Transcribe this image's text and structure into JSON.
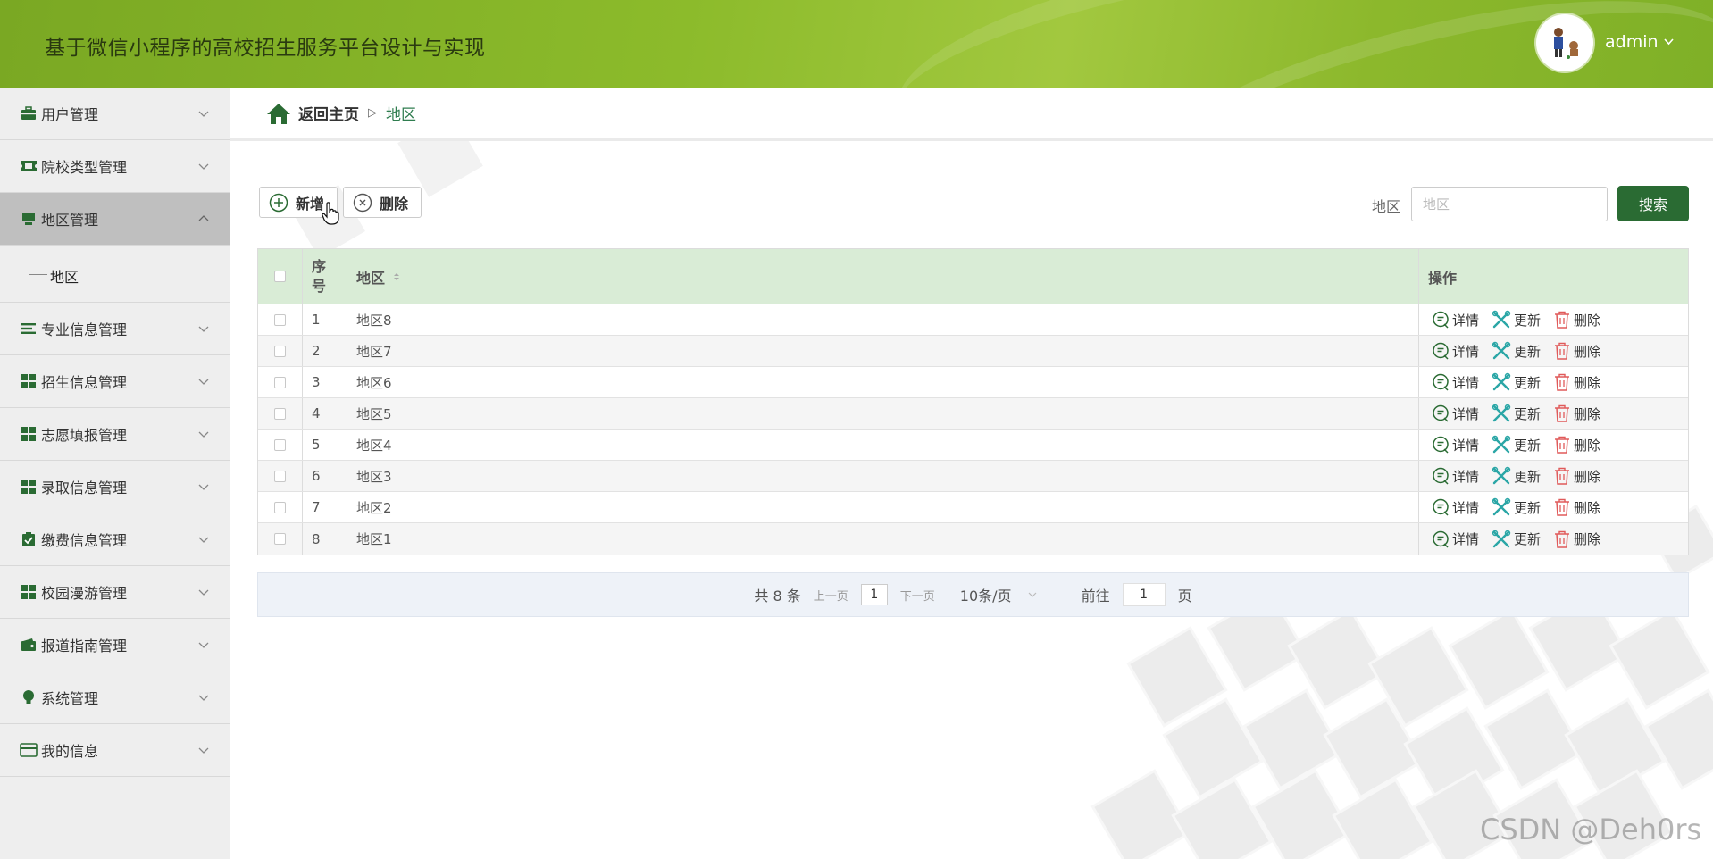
{
  "header": {
    "title": "基于微信小程序的高校招生服务平台设计与实现",
    "username": "admin"
  },
  "sidebar": {
    "items": [
      {
        "label": "用户管理",
        "icon": "briefcase-icon"
      },
      {
        "label": "院校类型管理",
        "icon": "ticket-icon"
      },
      {
        "label": "地区管理",
        "icon": "monitor-icon",
        "active": true,
        "children": [
          {
            "label": "地区"
          }
        ]
      },
      {
        "label": "专业信息管理",
        "icon": "list-icon"
      },
      {
        "label": "招生信息管理",
        "icon": "grid-icon"
      },
      {
        "label": "志愿填报管理",
        "icon": "grid-icon"
      },
      {
        "label": "录取信息管理",
        "icon": "grid-icon"
      },
      {
        "label": "缴费信息管理",
        "icon": "clipboard-check-icon"
      },
      {
        "label": "校园漫游管理",
        "icon": "grid-icon"
      },
      {
        "label": "报道指南管理",
        "icon": "wallet-icon"
      },
      {
        "label": "系统管理",
        "icon": "lightbulb-icon"
      },
      {
        "label": "我的信息",
        "icon": "card-icon"
      }
    ]
  },
  "breadcrumb": {
    "home": "返回主页",
    "current": "地区"
  },
  "toolbar": {
    "add_label": "新增",
    "delete_label": "删除",
    "search_label": "地区",
    "search_placeholder": "地区",
    "search_button": "搜索"
  },
  "table": {
    "headers": {
      "no": "序号",
      "no_line1": "序",
      "no_line2": "号",
      "area": "地区",
      "op": "操作"
    },
    "actions": {
      "detail": "详情",
      "update": "更新",
      "delete": "删除"
    },
    "rows": [
      {
        "no": "1",
        "area": "地区8"
      },
      {
        "no": "2",
        "area": "地区7"
      },
      {
        "no": "3",
        "area": "地区6"
      },
      {
        "no": "4",
        "area": "地区5"
      },
      {
        "no": "5",
        "area": "地区4"
      },
      {
        "no": "6",
        "area": "地区3"
      },
      {
        "no": "7",
        "area": "地区2"
      },
      {
        "no": "8",
        "area": "地区1"
      }
    ]
  },
  "pagination": {
    "total": "共 8 条",
    "prev": "上一页",
    "page": "1",
    "next": "下一页",
    "page_size": "10条/页",
    "goto_prefix": "前往",
    "goto_value": "1",
    "goto_suffix": "页"
  },
  "watermark": "CSDN @Deh0rs",
  "colors": {
    "header_green": "#8cbb2b",
    "accent_dark_green": "#2a6b33",
    "table_header_green": "#d9ecd6",
    "delete_red": "#e05a5a",
    "update_teal": "#2aa6a6"
  }
}
